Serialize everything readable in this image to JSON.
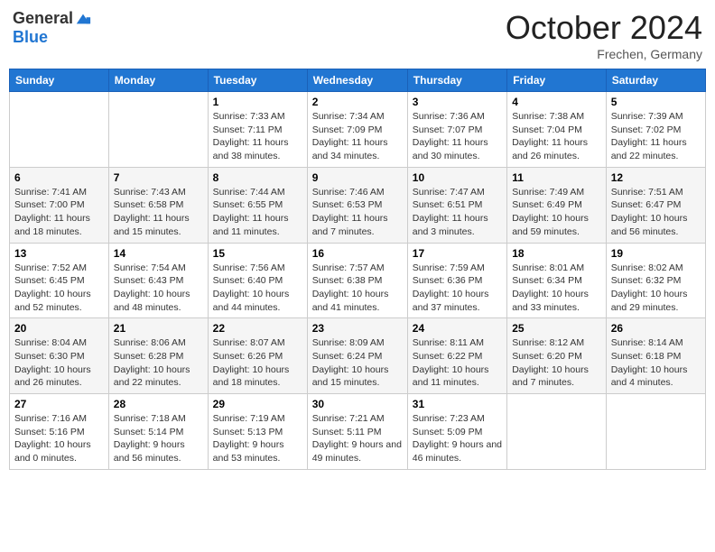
{
  "header": {
    "logo_general": "General",
    "logo_blue": "Blue",
    "month_title": "October 2024",
    "location": "Frechen, Germany"
  },
  "weekdays": [
    "Sunday",
    "Monday",
    "Tuesday",
    "Wednesday",
    "Thursday",
    "Friday",
    "Saturday"
  ],
  "weeks": [
    [
      {
        "day": "",
        "sunrise": "",
        "sunset": "",
        "daylight": ""
      },
      {
        "day": "",
        "sunrise": "",
        "sunset": "",
        "daylight": ""
      },
      {
        "day": "1",
        "sunrise": "Sunrise: 7:33 AM",
        "sunset": "Sunset: 7:11 PM",
        "daylight": "Daylight: 11 hours and 38 minutes."
      },
      {
        "day": "2",
        "sunrise": "Sunrise: 7:34 AM",
        "sunset": "Sunset: 7:09 PM",
        "daylight": "Daylight: 11 hours and 34 minutes."
      },
      {
        "day": "3",
        "sunrise": "Sunrise: 7:36 AM",
        "sunset": "Sunset: 7:07 PM",
        "daylight": "Daylight: 11 hours and 30 minutes."
      },
      {
        "day": "4",
        "sunrise": "Sunrise: 7:38 AM",
        "sunset": "Sunset: 7:04 PM",
        "daylight": "Daylight: 11 hours and 26 minutes."
      },
      {
        "day": "5",
        "sunrise": "Sunrise: 7:39 AM",
        "sunset": "Sunset: 7:02 PM",
        "daylight": "Daylight: 11 hours and 22 minutes."
      }
    ],
    [
      {
        "day": "6",
        "sunrise": "Sunrise: 7:41 AM",
        "sunset": "Sunset: 7:00 PM",
        "daylight": "Daylight: 11 hours and 18 minutes."
      },
      {
        "day": "7",
        "sunrise": "Sunrise: 7:43 AM",
        "sunset": "Sunset: 6:58 PM",
        "daylight": "Daylight: 11 hours and 15 minutes."
      },
      {
        "day": "8",
        "sunrise": "Sunrise: 7:44 AM",
        "sunset": "Sunset: 6:55 PM",
        "daylight": "Daylight: 11 hours and 11 minutes."
      },
      {
        "day": "9",
        "sunrise": "Sunrise: 7:46 AM",
        "sunset": "Sunset: 6:53 PM",
        "daylight": "Daylight: 11 hours and 7 minutes."
      },
      {
        "day": "10",
        "sunrise": "Sunrise: 7:47 AM",
        "sunset": "Sunset: 6:51 PM",
        "daylight": "Daylight: 11 hours and 3 minutes."
      },
      {
        "day": "11",
        "sunrise": "Sunrise: 7:49 AM",
        "sunset": "Sunset: 6:49 PM",
        "daylight": "Daylight: 10 hours and 59 minutes."
      },
      {
        "day": "12",
        "sunrise": "Sunrise: 7:51 AM",
        "sunset": "Sunset: 6:47 PM",
        "daylight": "Daylight: 10 hours and 56 minutes."
      }
    ],
    [
      {
        "day": "13",
        "sunrise": "Sunrise: 7:52 AM",
        "sunset": "Sunset: 6:45 PM",
        "daylight": "Daylight: 10 hours and 52 minutes."
      },
      {
        "day": "14",
        "sunrise": "Sunrise: 7:54 AM",
        "sunset": "Sunset: 6:43 PM",
        "daylight": "Daylight: 10 hours and 48 minutes."
      },
      {
        "day": "15",
        "sunrise": "Sunrise: 7:56 AM",
        "sunset": "Sunset: 6:40 PM",
        "daylight": "Daylight: 10 hours and 44 minutes."
      },
      {
        "day": "16",
        "sunrise": "Sunrise: 7:57 AM",
        "sunset": "Sunset: 6:38 PM",
        "daylight": "Daylight: 10 hours and 41 minutes."
      },
      {
        "day": "17",
        "sunrise": "Sunrise: 7:59 AM",
        "sunset": "Sunset: 6:36 PM",
        "daylight": "Daylight: 10 hours and 37 minutes."
      },
      {
        "day": "18",
        "sunrise": "Sunrise: 8:01 AM",
        "sunset": "Sunset: 6:34 PM",
        "daylight": "Daylight: 10 hours and 33 minutes."
      },
      {
        "day": "19",
        "sunrise": "Sunrise: 8:02 AM",
        "sunset": "Sunset: 6:32 PM",
        "daylight": "Daylight: 10 hours and 29 minutes."
      }
    ],
    [
      {
        "day": "20",
        "sunrise": "Sunrise: 8:04 AM",
        "sunset": "Sunset: 6:30 PM",
        "daylight": "Daylight: 10 hours and 26 minutes."
      },
      {
        "day": "21",
        "sunrise": "Sunrise: 8:06 AM",
        "sunset": "Sunset: 6:28 PM",
        "daylight": "Daylight: 10 hours and 22 minutes."
      },
      {
        "day": "22",
        "sunrise": "Sunrise: 8:07 AM",
        "sunset": "Sunset: 6:26 PM",
        "daylight": "Daylight: 10 hours and 18 minutes."
      },
      {
        "day": "23",
        "sunrise": "Sunrise: 8:09 AM",
        "sunset": "Sunset: 6:24 PM",
        "daylight": "Daylight: 10 hours and 15 minutes."
      },
      {
        "day": "24",
        "sunrise": "Sunrise: 8:11 AM",
        "sunset": "Sunset: 6:22 PM",
        "daylight": "Daylight: 10 hours and 11 minutes."
      },
      {
        "day": "25",
        "sunrise": "Sunrise: 8:12 AM",
        "sunset": "Sunset: 6:20 PM",
        "daylight": "Daylight: 10 hours and 7 minutes."
      },
      {
        "day": "26",
        "sunrise": "Sunrise: 8:14 AM",
        "sunset": "Sunset: 6:18 PM",
        "daylight": "Daylight: 10 hours and 4 minutes."
      }
    ],
    [
      {
        "day": "27",
        "sunrise": "Sunrise: 7:16 AM",
        "sunset": "Sunset: 5:16 PM",
        "daylight": "Daylight: 10 hours and 0 minutes."
      },
      {
        "day": "28",
        "sunrise": "Sunrise: 7:18 AM",
        "sunset": "Sunset: 5:14 PM",
        "daylight": "Daylight: 9 hours and 56 minutes."
      },
      {
        "day": "29",
        "sunrise": "Sunrise: 7:19 AM",
        "sunset": "Sunset: 5:13 PM",
        "daylight": "Daylight: 9 hours and 53 minutes."
      },
      {
        "day": "30",
        "sunrise": "Sunrise: 7:21 AM",
        "sunset": "Sunset: 5:11 PM",
        "daylight": "Daylight: 9 hours and 49 minutes."
      },
      {
        "day": "31",
        "sunrise": "Sunrise: 7:23 AM",
        "sunset": "Sunset: 5:09 PM",
        "daylight": "Daylight: 9 hours and 46 minutes."
      },
      {
        "day": "",
        "sunrise": "",
        "sunset": "",
        "daylight": ""
      },
      {
        "day": "",
        "sunrise": "",
        "sunset": "",
        "daylight": ""
      }
    ]
  ]
}
